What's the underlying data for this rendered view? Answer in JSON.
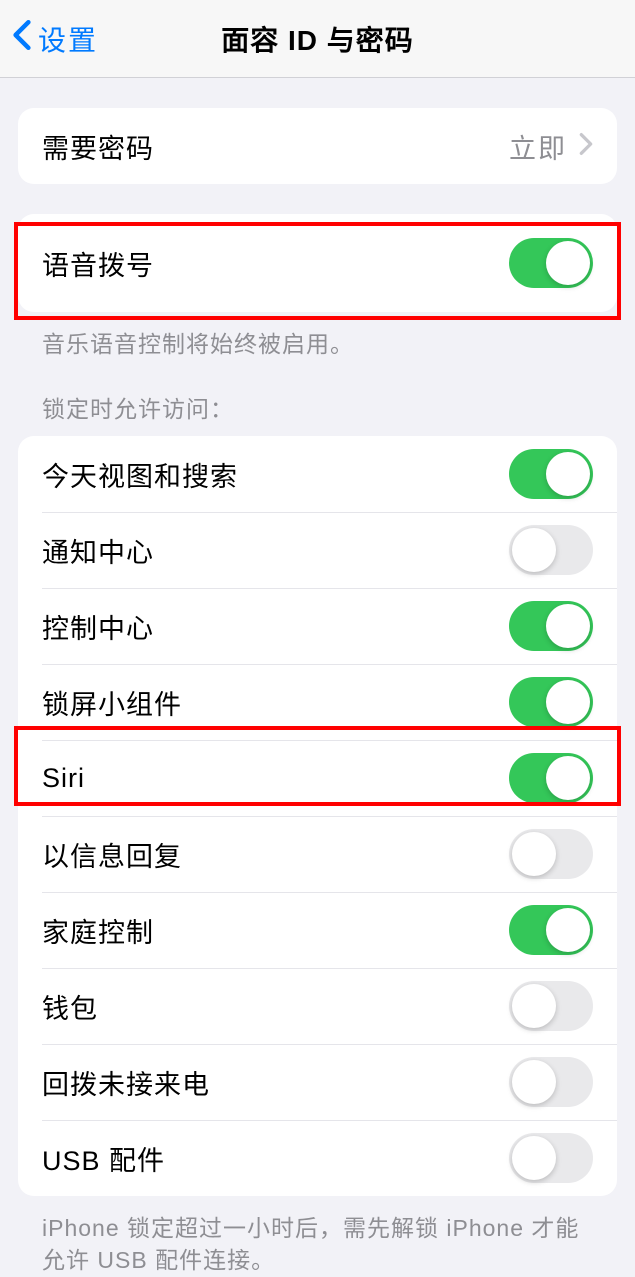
{
  "header": {
    "back_label": "设置",
    "title": "面容 ID 与密码"
  },
  "passcode": {
    "label": "需要密码",
    "value": "立即"
  },
  "voice_dial": {
    "label": "语音拨号",
    "on": true,
    "footer": "音乐语音控制将始终被启用。"
  },
  "lock_access": {
    "header": "锁定时允许访问：",
    "items": [
      {
        "label": "今天视图和搜索",
        "on": true
      },
      {
        "label": "通知中心",
        "on": false
      },
      {
        "label": "控制中心",
        "on": true
      },
      {
        "label": "锁屏小组件",
        "on": true
      },
      {
        "label": "Siri",
        "on": true
      },
      {
        "label": "以信息回复",
        "on": false
      },
      {
        "label": "家庭控制",
        "on": true
      },
      {
        "label": "钱包",
        "on": false
      },
      {
        "label": "回拨未接来电",
        "on": false
      },
      {
        "label": "USB 配件",
        "on": false
      }
    ],
    "footer": "iPhone 锁定超过一小时后，需先解锁 iPhone 才能允许 USB 配件连接。"
  }
}
